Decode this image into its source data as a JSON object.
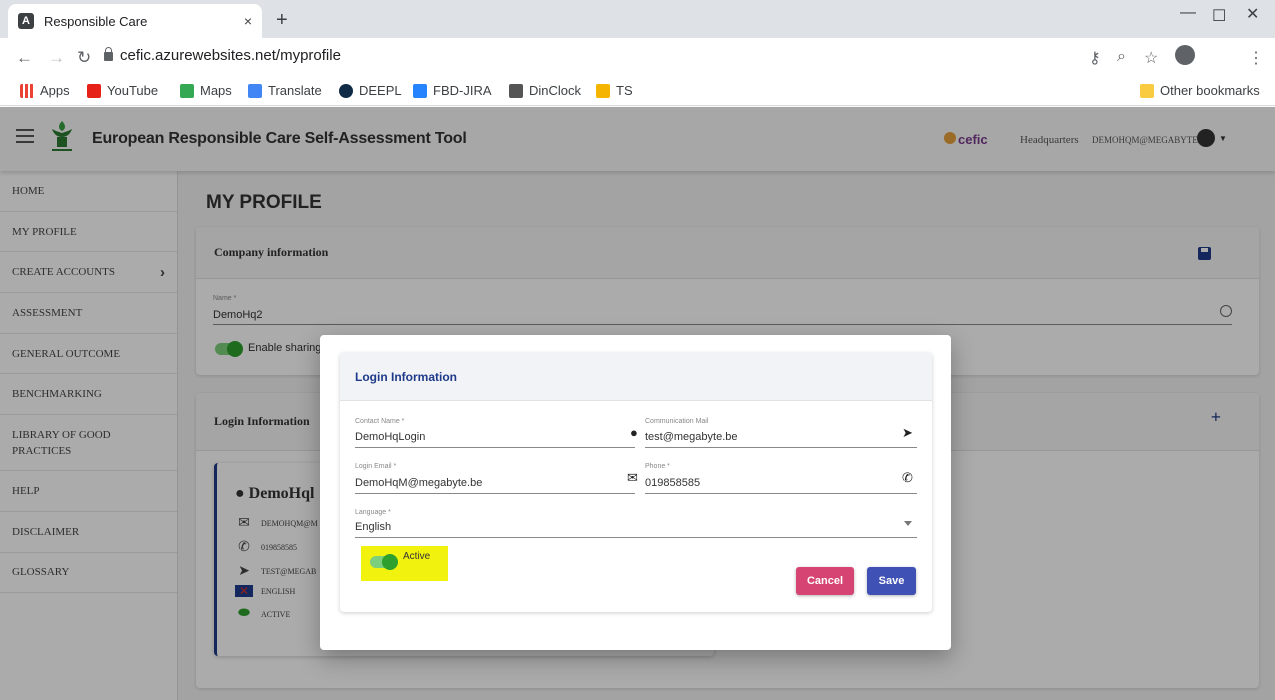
{
  "browser": {
    "tab_title": "Responsible Care",
    "tab_close": "×",
    "new_tab": "+",
    "url": "cefic.azurewebsites.net/myprofile",
    "bookmarks": [
      "Apps",
      "YouTube",
      "Maps",
      "Translate",
      "DEEPL",
      "FBD-JIRA",
      "DinClock",
      "TS"
    ],
    "other_bookmarks": "Other bookmarks"
  },
  "app": {
    "title": "European Responsible Care Self-Assessment Tool",
    "org_logo_text": "cefic",
    "org_name": "Headquarters",
    "user_email": "DEMOHQM@MEGABYTE.BE"
  },
  "sidebar": {
    "items": [
      {
        "label": "HOME"
      },
      {
        "label": "MY PROFILE"
      },
      {
        "label": "CREATE ACCOUNTS"
      },
      {
        "label": "ASSESSMENT"
      },
      {
        "label": "GENERAL OUTCOME"
      },
      {
        "label": "BENCHMARKING"
      },
      {
        "label": "LIBRARY OF GOOD PRACTICES"
      },
      {
        "label": "HELP"
      },
      {
        "label": "DISCLAIMER"
      },
      {
        "label": "GLOSSARY"
      }
    ]
  },
  "page": {
    "title": "MY PROFILE",
    "company": {
      "header": "Company information",
      "name_label": "Name *",
      "name_value": "DemoHq2",
      "sharing_label": "Enable sharing"
    },
    "login": {
      "header": "Login Information",
      "add": "+",
      "card": {
        "name": "DemoHql",
        "email": "DEMOHQM@M",
        "phone": "019858585",
        "comm_mail": "TEST@MEGAB",
        "language": "ENGLISH",
        "status": "ACTIVE"
      }
    }
  },
  "dialog": {
    "title": "Login Information",
    "contact_name_label": "Contact Name *",
    "contact_name_value": "DemoHqLogin",
    "comm_mail_label": "Communication Mail",
    "comm_mail_value": "test@megabyte.be",
    "login_email_label": "Login Email *",
    "login_email_value": "DemoHqM@megabyte.be",
    "phone_label": "Phone *",
    "phone_value": "019858585",
    "language_label": "Language *",
    "language_value": "English",
    "active_label": "Active",
    "cancel_label": "Cancel",
    "save_label": "Save"
  },
  "colors": {
    "primary": "#3f51b5",
    "cancel": "#d64473",
    "toggle": "#2ea02e",
    "highlight": "#f2f20f"
  }
}
